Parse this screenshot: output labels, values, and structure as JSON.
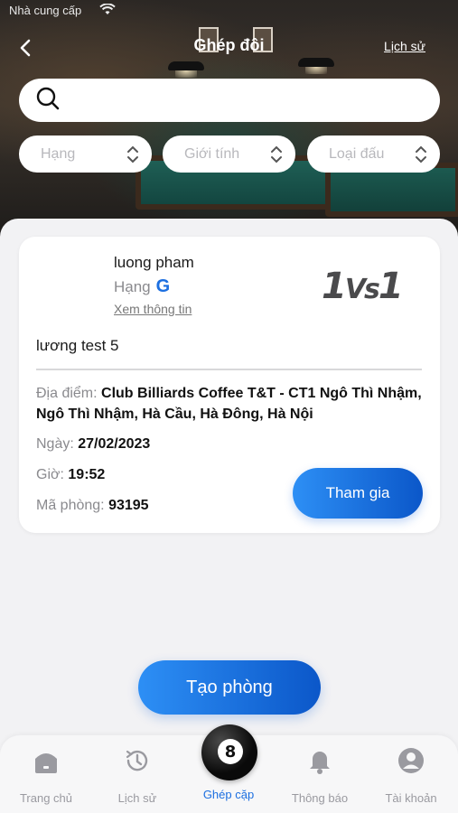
{
  "status_bar": {
    "carrier": "Nhà cung cấp"
  },
  "header": {
    "title": "Ghép đôi",
    "history_link": "Lịch sử"
  },
  "search": {
    "value": "",
    "placeholder": ""
  },
  "filters": [
    {
      "label": "Hạng"
    },
    {
      "label": "Giới tính"
    },
    {
      "label": "Loại đấu"
    }
  ],
  "card": {
    "username": "luong pham",
    "rank_label": "Hạng",
    "rank_value": "G",
    "view_info": "Xem thông tin",
    "match_type": {
      "left": "1",
      "vs": "Vs",
      "right": "1"
    },
    "match_name": "lương test 5",
    "location_label": "Địa điểm:",
    "location_value": "Club Billiards Coffee T&T - CT1 Ngô Thì Nhậm, Ngô Thì Nhậm, Hà Cầu, Hà Đông, Hà Nội",
    "date_label": "Ngày:",
    "date_value": "27/02/2023",
    "time_label": "Giờ:",
    "time_value": "19:52",
    "room_label": "Mã phòng:",
    "room_value": "93195",
    "join_button": "Tham gia"
  },
  "create_button": "Tạo phòng",
  "tabbar": {
    "tabs": [
      {
        "label": "Trang chủ",
        "icon": "home-icon"
      },
      {
        "label": "Lịch sử",
        "icon": "history-icon"
      },
      {
        "label": "Ghép cặp",
        "icon": "eight-ball-icon",
        "active": true
      },
      {
        "label": "Thông báo",
        "icon": "bell-icon"
      },
      {
        "label": "Tài khoản",
        "icon": "account-icon"
      }
    ],
    "ball_number": "8"
  },
  "colors": {
    "accent": "#1c6fe0",
    "button_gradient_start": "#2d8ff5",
    "button_gradient_end": "#0b57c9"
  }
}
